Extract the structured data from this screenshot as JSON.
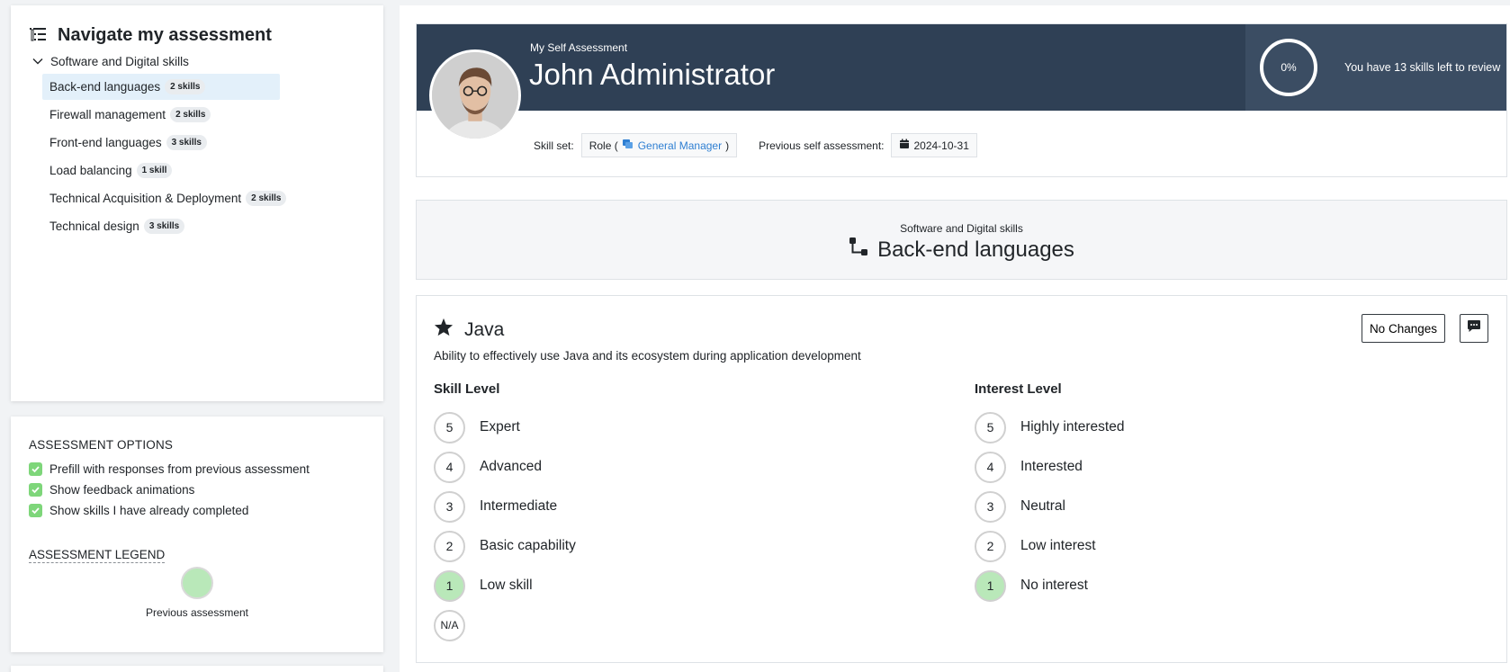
{
  "nav": {
    "title": "Navigate my assessment",
    "group": "Software and Digital skills",
    "items": [
      {
        "label": "Back-end languages",
        "count": "2 skills"
      },
      {
        "label": "Firewall management",
        "count": "2 skills"
      },
      {
        "label": "Front-end languages",
        "count": "3 skills"
      },
      {
        "label": "Load balancing",
        "count": "1 skill"
      },
      {
        "label": "Technical Acquisition & Deployment",
        "count": "2 skills"
      },
      {
        "label": "Technical design",
        "count": "3 skills"
      }
    ]
  },
  "options": {
    "heading": "ASSESSMENT OPTIONS",
    "items": [
      "Prefill with responses from previous assessment",
      "Show feedback animations",
      "Show skills I have already completed"
    ],
    "legend_heading": "ASSESSMENT LEGEND",
    "legend_label": "Previous assessment"
  },
  "profile": {
    "subtitle": "My Self Assessment",
    "name": "John Administrator",
    "progress": "0%",
    "progress_text": "You have 13 skills left to review",
    "skill_set_label": "Skill set:",
    "role_prefix": "Role (",
    "role_name": "General Manager",
    "role_suffix": ")",
    "previous_label": "Previous self assessment:",
    "previous_date": "2024-10-31"
  },
  "category": {
    "parent": "Software and Digital skills",
    "title": "Back-end languages"
  },
  "skill": {
    "name": "Java",
    "description": "Ability to effectively use Java and its ecosystem during application development",
    "no_changes": "No Changes",
    "skill_level_title": "Skill Level",
    "interest_level_title": "Interest Level",
    "skill_levels": [
      {
        "n": "5",
        "label": "Expert"
      },
      {
        "n": "4",
        "label": "Advanced"
      },
      {
        "n": "3",
        "label": "Intermediate"
      },
      {
        "n": "2",
        "label": "Basic capability"
      },
      {
        "n": "1",
        "label": "Low skill"
      },
      {
        "n": "N/A",
        "label": ""
      }
    ],
    "interest_levels": [
      {
        "n": "5",
        "label": "Highly interested"
      },
      {
        "n": "4",
        "label": "Interested"
      },
      {
        "n": "3",
        "label": "Neutral"
      },
      {
        "n": "2",
        "label": "Low interest"
      },
      {
        "n": "1",
        "label": "No interest"
      }
    ]
  },
  "colors": {
    "banner": "#2f4055",
    "previous_green": "#b9e8b9",
    "checkbox_green": "#7ed67a",
    "link_blue": "#2f7fd2"
  }
}
